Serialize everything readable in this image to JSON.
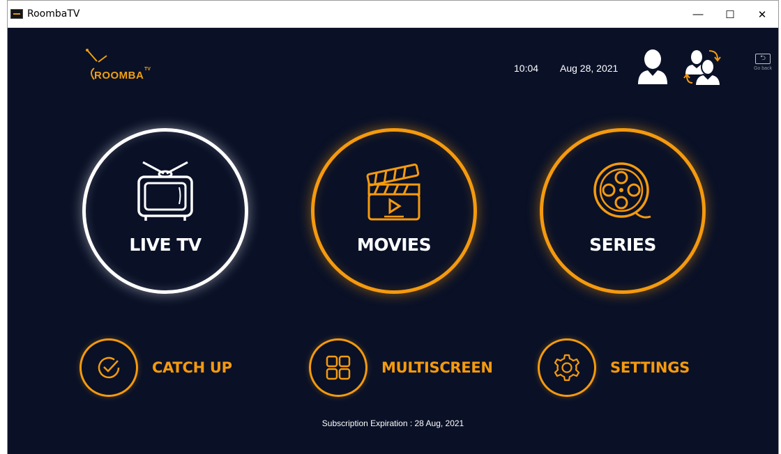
{
  "window": {
    "title": "RoombaTV",
    "minimize_glyph": "—",
    "maximize_glyph": "☐",
    "close_glyph": "✕"
  },
  "logo": {
    "brand": "ROOMBA",
    "superscript": "TV"
  },
  "header": {
    "time": "10:04",
    "date": "Aug 28, 2021",
    "goback_label": "Go back",
    "icons": [
      "profile-icon",
      "switch-user-icon",
      "go-back-icon"
    ]
  },
  "tiles": [
    {
      "label": "LIVE TV",
      "icon": "tv-icon",
      "color": "#ffffff"
    },
    {
      "label": "MOVIES",
      "icon": "clapperboard-icon",
      "color": "#f59a0e"
    },
    {
      "label": "SERIES",
      "icon": "film-reel-icon",
      "color": "#f59a0e"
    }
  ],
  "small_tiles": [
    {
      "label": "CATCH UP",
      "icon": "check-circle-icon"
    },
    {
      "label": "MULTISCREEN",
      "icon": "grid-icon"
    },
    {
      "label": "SETTINGS",
      "icon": "gear-icon"
    }
  ],
  "footer": {
    "subscription": "Subscription Expiration : 28 Aug, 2021"
  },
  "colors": {
    "background": "#0a1127",
    "accent": "#f59a0e",
    "white": "#ffffff"
  }
}
